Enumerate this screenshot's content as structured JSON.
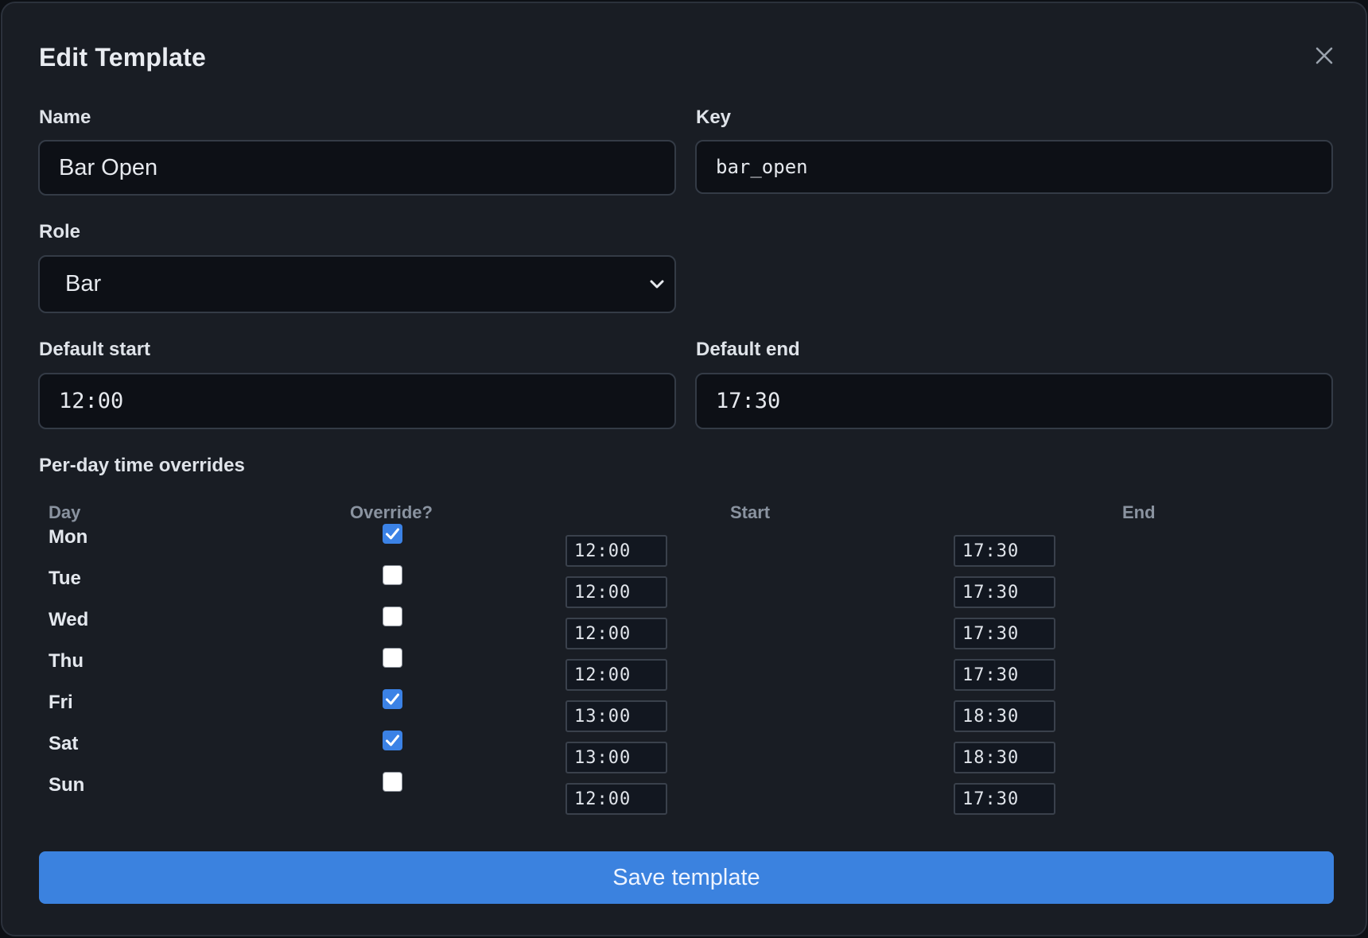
{
  "modal": {
    "title": "Edit Template",
    "close_icon": "close-icon"
  },
  "form": {
    "name": {
      "label": "Name",
      "value": "Bar Open"
    },
    "key": {
      "label": "Key",
      "value": "bar_open"
    },
    "role": {
      "label": "Role",
      "value": "Bar"
    },
    "default_start": {
      "label": "Default start",
      "value": "12:00"
    },
    "default_end": {
      "label": "Default end",
      "value": "17:30"
    }
  },
  "overrides": {
    "section_title": "Per-day time overrides",
    "headers": {
      "day": "Day",
      "override": "Override?",
      "start": "Start",
      "end": "End"
    },
    "rows": [
      {
        "day": "Mon",
        "override": true,
        "start": "12:00",
        "end": "17:30"
      },
      {
        "day": "Tue",
        "override": false,
        "start": "12:00",
        "end": "17:30"
      },
      {
        "day": "Wed",
        "override": false,
        "start": "12:00",
        "end": "17:30"
      },
      {
        "day": "Thu",
        "override": false,
        "start": "12:00",
        "end": "17:30"
      },
      {
        "day": "Fri",
        "override": true,
        "start": "13:00",
        "end": "18:30"
      },
      {
        "day": "Sat",
        "override": true,
        "start": "13:00",
        "end": "18:30"
      },
      {
        "day": "Sun",
        "override": false,
        "start": "12:00",
        "end": "17:30"
      }
    ]
  },
  "actions": {
    "save_label": "Save template"
  },
  "colors": {
    "accent": "#3b82df",
    "background": "#191d24",
    "input_background": "#0d1016"
  }
}
